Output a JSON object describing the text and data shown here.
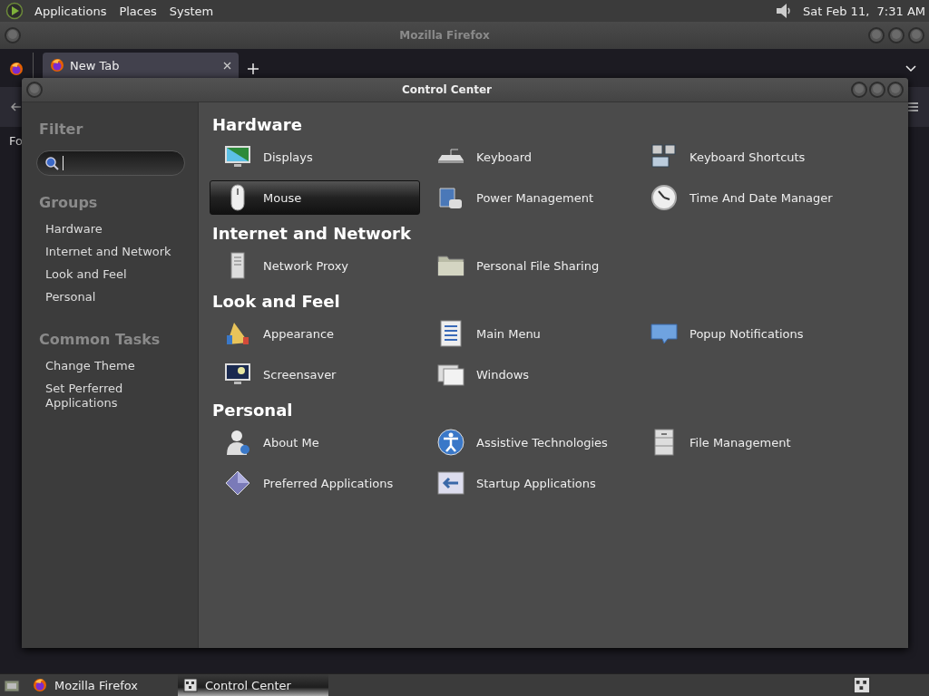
{
  "top_panel": {
    "menus": [
      "Applications",
      "Places",
      "System"
    ],
    "clock": "Sat Feb 11,  7:31 AM"
  },
  "browser_window": {
    "title": "Mozilla Firefox",
    "tabs": [
      {
        "label": "New Tab",
        "selected": true
      }
    ],
    "content_text": "Fo"
  },
  "control_center": {
    "title": "Control Center",
    "filter": {
      "heading": "Filter",
      "placeholder_focused": true
    },
    "groups": {
      "heading": "Groups",
      "items": [
        "Hardware",
        "Internet and Network",
        "Look and Feel",
        "Personal"
      ]
    },
    "common_tasks": {
      "heading": "Common Tasks",
      "items": [
        "Change Theme",
        "Set Perferred Applications"
      ]
    },
    "sections": [
      {
        "title": "Hardware",
        "items": [
          {
            "label": "Displays",
            "selected": false
          },
          {
            "label": "Keyboard",
            "selected": false
          },
          {
            "label": "Keyboard Shortcuts",
            "selected": false
          },
          {
            "label": "Mouse",
            "selected": true
          },
          {
            "label": "Power Management",
            "selected": false
          },
          {
            "label": "Time And Date Manager",
            "selected": false
          }
        ]
      },
      {
        "title": "Internet and Network",
        "items": [
          {
            "label": "Network Proxy",
            "selected": false
          },
          {
            "label": "Personal File Sharing",
            "selected": false
          }
        ]
      },
      {
        "title": "Look and Feel",
        "items": [
          {
            "label": "Appearance",
            "selected": false
          },
          {
            "label": "Main Menu",
            "selected": false
          },
          {
            "label": "Popup Notifications",
            "selected": false
          },
          {
            "label": "Screensaver",
            "selected": false
          },
          {
            "label": "Windows",
            "selected": false
          }
        ]
      },
      {
        "title": "Personal",
        "items": [
          {
            "label": "About Me",
            "selected": false
          },
          {
            "label": "Assistive Technologies",
            "selected": false
          },
          {
            "label": "File Management",
            "selected": false
          },
          {
            "label": "Preferred Applications",
            "selected": false
          },
          {
            "label": "Startup Applications",
            "selected": false
          }
        ]
      }
    ]
  },
  "taskbar": {
    "items": [
      {
        "label": "Mozilla Firefox",
        "selected": false
      },
      {
        "label": "Control Center",
        "selected": true
      }
    ]
  }
}
